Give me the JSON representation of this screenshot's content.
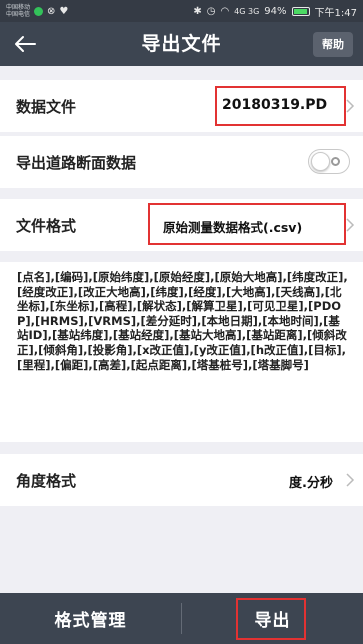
{
  "status_bar": {
    "carrier_line1": "中国移动",
    "carrier_line2": "中国电信",
    "signal_text": "4G 3G",
    "battery": "94%",
    "time": "下午1:47",
    "battery_level": 0.94
  },
  "header": {
    "title": "导出文件",
    "help_label": "帮助"
  },
  "rows": {
    "data_file": {
      "label": "数据文件",
      "value": "20180319.PD"
    },
    "export_road": {
      "label": "导出道路断面数据",
      "toggle_on": false
    },
    "file_format": {
      "label": "文件格式",
      "value": "原始测量数据格式(.csv)"
    },
    "angle_format": {
      "label": "角度格式",
      "value": "度.分秒"
    }
  },
  "description": "[点名],[编码],[原始纬度],[原始经度],[原始大地高],[纬度改正],[经度改正],[改正大地高],[纬度],[经度],[大地高],[天线高],[北坐标],[东坐标],[高程],[解状态],[解算卫星],[可见卫星],[PDOP],[HRMS],[VRMS],[差分延时],[本地日期],[本地时间],[基站ID],[基站纬度],[基站经度],[基站大地高],[基站距离],[倾斜改正],[倾斜角],[投影角],[x改正值],[y改正值],[h改正值],[目标],[里程],[偏距],[高差],[起点距离],[塔基桩号],[塔基脚号]",
  "bottom": {
    "format_manage_label": "格式管理",
    "export_label": "导出"
  },
  "colors": {
    "header_bg": "#3d4551",
    "highlight_box": "#e23232",
    "page_bg": "#efeff4"
  }
}
